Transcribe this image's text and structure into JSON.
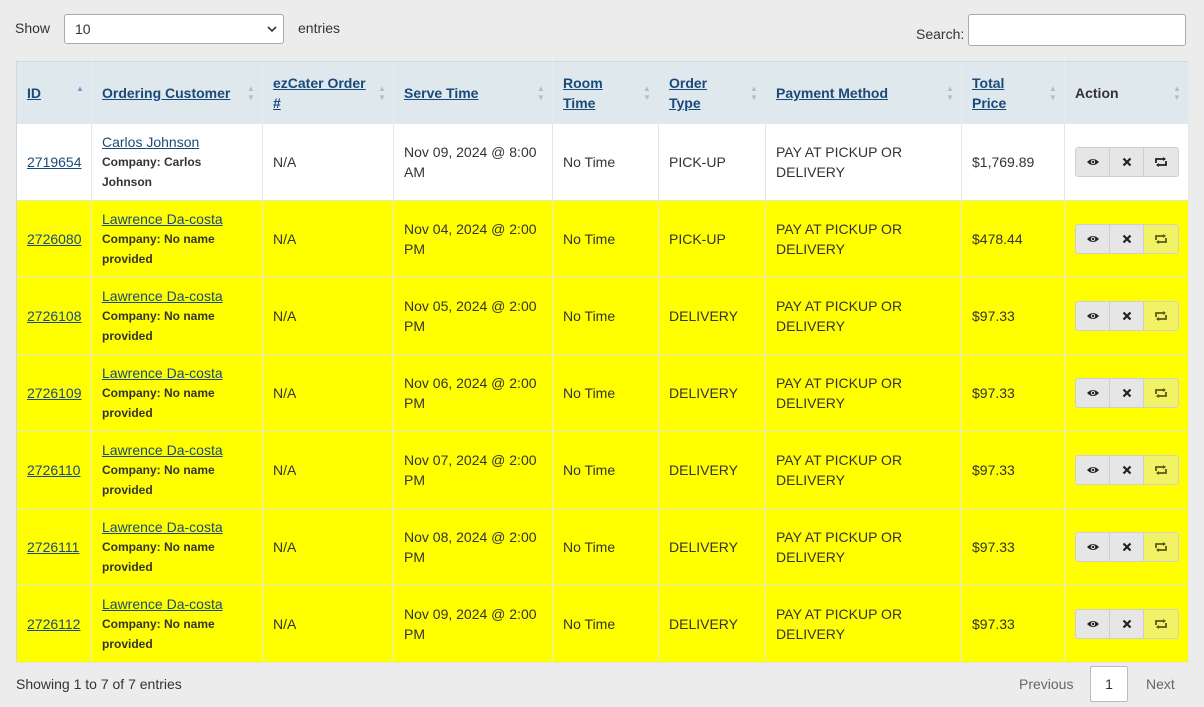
{
  "controls": {
    "show_label": "Show",
    "page_length": "10",
    "entries_label": "entries",
    "search_label": "Search:",
    "search_value": ""
  },
  "table": {
    "headers": {
      "id": "ID",
      "customer": "Ordering Customer",
      "ezcater": "ezCater Order #",
      "serve_time": "Serve Time",
      "room_time": "Room Time",
      "order_type": "Order Type",
      "payment": "Payment Method",
      "total": "Total Price",
      "action": "Action"
    },
    "rows": [
      {
        "id": "2719654",
        "customer": "Carlos Johnson",
        "company": "Company: Carlos Johnson",
        "ezcater": "N/A",
        "serve_time": "Nov 09, 2024 @ 8:00 AM",
        "room_time": "No Time",
        "order_type": "PICK-UP",
        "payment": "PAY AT PICKUP OR DELIVERY",
        "total": "$1,769.89",
        "highlight": false
      },
      {
        "id": "2726080",
        "customer": "Lawrence Da-costa",
        "company": "Company: No name provided",
        "ezcater": "N/A",
        "serve_time": "Nov 04, 2024 @ 2:00 PM",
        "room_time": "No Time",
        "order_type": "PICK-UP",
        "payment": "PAY AT PICKUP OR DELIVERY",
        "total": "$478.44",
        "highlight": true
      },
      {
        "id": "2726108",
        "customer": "Lawrence Da-costa",
        "company": "Company: No name provided",
        "ezcater": "N/A",
        "serve_time": "Nov 05, 2024 @ 2:00 PM",
        "room_time": "No Time",
        "order_type": "DELIVERY",
        "payment": "PAY AT PICKUP OR DELIVERY",
        "total": "$97.33",
        "highlight": true
      },
      {
        "id": "2726109",
        "customer": "Lawrence Da-costa",
        "company": "Company: No name provided",
        "ezcater": "N/A",
        "serve_time": "Nov 06, 2024 @ 2:00 PM",
        "room_time": "No Time",
        "order_type": "DELIVERY",
        "payment": "PAY AT PICKUP OR DELIVERY",
        "total": "$97.33",
        "highlight": true
      },
      {
        "id": "2726110",
        "customer": "Lawrence Da-costa",
        "company": "Company: No name provided",
        "ezcater": "N/A",
        "serve_time": "Nov 07, 2024 @ 2:00 PM",
        "room_time": "No Time",
        "order_type": "DELIVERY",
        "payment": "PAY AT PICKUP OR DELIVERY",
        "total": "$97.33",
        "highlight": true
      },
      {
        "id": "2726111",
        "customer": "Lawrence Da-costa",
        "company": "Company: No name provided",
        "ezcater": "N/A",
        "serve_time": "Nov 08, 2024 @ 2:00 PM",
        "room_time": "No Time",
        "order_type": "DELIVERY",
        "payment": "PAY AT PICKUP OR DELIVERY",
        "total": "$97.33",
        "highlight": true
      },
      {
        "id": "2726112",
        "customer": "Lawrence Da-costa",
        "company": "Company: No name provided",
        "ezcater": "N/A",
        "serve_time": "Nov 09, 2024 @ 2:00 PM",
        "room_time": "No Time",
        "order_type": "DELIVERY",
        "payment": "PAY AT PICKUP OR DELIVERY",
        "total": "$97.33",
        "highlight": true
      }
    ],
    "action_icons": [
      "eye-icon",
      "close-icon",
      "refresh-icon"
    ]
  },
  "footer": {
    "info": "Showing 1 to 7 of 7 entries",
    "previous": "Previous",
    "current_page": "1",
    "next": "Next"
  },
  "colors": {
    "highlight_row": "#ffff00",
    "header_bg": "#dfe8ec",
    "link": "#1a4a7a"
  }
}
